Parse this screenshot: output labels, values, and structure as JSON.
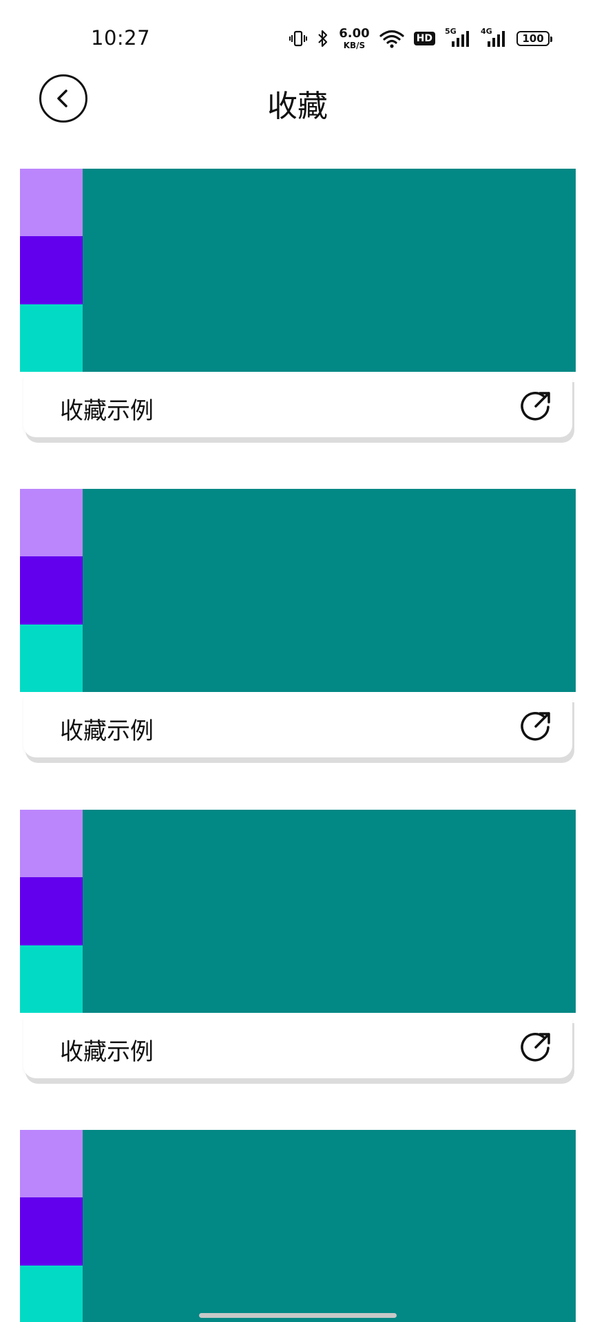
{
  "status_bar": {
    "time": "10:27",
    "net_speed_value": "6.00",
    "net_speed_unit": "KB/S",
    "hd_label": "HD",
    "signal_1_label": "5G",
    "signal_2_label": "4G",
    "battery": "100",
    "icons": [
      "vibrate-icon",
      "bluetooth-icon",
      "wifi-icon",
      "hd-icon",
      "signal-5g-icon",
      "signal-4g-icon",
      "battery-icon"
    ]
  },
  "header": {
    "title": "收藏",
    "back_icon": "chevron-left-icon"
  },
  "favorites": [
    {
      "title": "收藏示例",
      "thumbnail_colors": [
        "#BB86FC",
        "#6200EE",
        "#03DAC5",
        "#028885"
      ],
      "action_icon": "open-external-icon"
    },
    {
      "title": "收藏示例",
      "thumbnail_colors": [
        "#BB86FC",
        "#6200EE",
        "#03DAC5",
        "#028885"
      ],
      "action_icon": "open-external-icon"
    },
    {
      "title": "收藏示例",
      "thumbnail_colors": [
        "#BB86FC",
        "#6200EE",
        "#03DAC5",
        "#028885"
      ],
      "action_icon": "open-external-icon"
    },
    {
      "title": "",
      "thumbnail_colors": [
        "#BB86FC",
        "#6200EE",
        "#03DAC5",
        "#028885"
      ],
      "action_icon": "open-external-icon"
    }
  ],
  "colors": {
    "thumbnail_bg": "#028885",
    "swatch_light_purple": "#BB86FC",
    "swatch_purple": "#6200EE",
    "swatch_teal": "#03DAC5"
  }
}
